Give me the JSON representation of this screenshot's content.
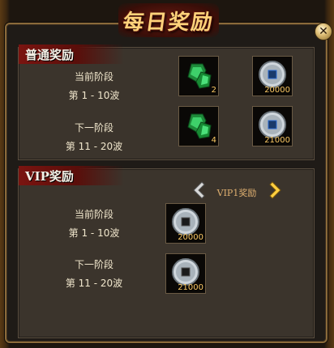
{
  "window": {
    "title": "每日奖励"
  },
  "normal_section": {
    "title": "普通奖励",
    "current": {
      "stage_label": "当前阶段",
      "wave_range": "第 1 - 10波",
      "rewards": [
        {
          "icon": "jade-gem-icon",
          "count": "2"
        },
        {
          "icon": "silver-coin-icon",
          "count": "20000"
        }
      ]
    },
    "next": {
      "stage_label": "下一阶段",
      "wave_range": "第 11 - 20波",
      "rewards": [
        {
          "icon": "jade-gem-icon",
          "count": "4"
        },
        {
          "icon": "silver-coin-icon",
          "count": "21000"
        }
      ]
    }
  },
  "vip_section": {
    "title": "VIP奖励",
    "tab_label": "VIP1奖励",
    "current": {
      "stage_label": "当前阶段",
      "wave_range": "第 1 - 10波",
      "rewards": [
        {
          "icon": "silver-coin-icon",
          "count": "20000"
        }
      ]
    },
    "next": {
      "stage_label": "下一阶段",
      "wave_range": "第 11 - 20波",
      "rewards": [
        {
          "icon": "silver-coin-icon",
          "count": "21000"
        }
      ]
    }
  },
  "colors": {
    "accent_red": "#7a1410",
    "gold": "#ffd27a",
    "panel": "#3b342c"
  }
}
